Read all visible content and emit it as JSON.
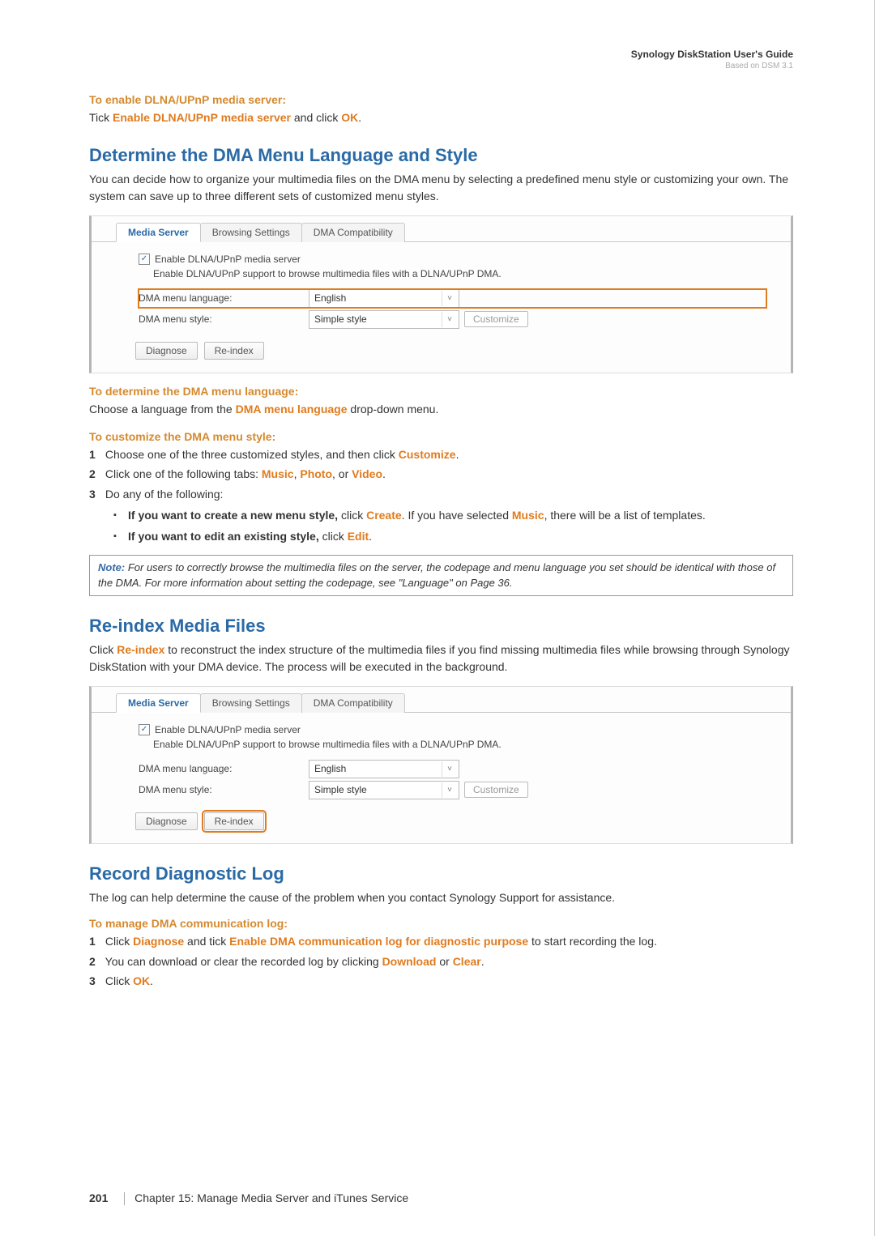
{
  "header": {
    "title": "Synology DiskStation User's Guide",
    "subtitle": "Based on DSM 3.1"
  },
  "enable_section": {
    "sub": "To enable DLNA/UPnP media server:",
    "line_prefix": "Tick ",
    "bold_link": "Enable DLNA/UPnP media server",
    "mid": " and click ",
    "bold_ok": "OK",
    "suffix": "."
  },
  "determine_section": {
    "heading": "Determine the DMA Menu Language and Style",
    "para": "You can decide how to organize your multimedia files on the DMA menu by selecting a predefined menu style or customizing your own. The system can save up to three different sets of customized menu styles."
  },
  "ui_panel": {
    "tabs": [
      "Media Server",
      "Browsing Settings",
      "DMA Compatibility"
    ],
    "checkbox_label": "Enable DLNA/UPnP media server",
    "checkbox_desc": "Enable DLNA/UPnP support to browse multimedia files with a DLNA/UPnP DMA.",
    "lang_label": "DMA menu language:",
    "lang_value": "English",
    "style_label": "DMA menu style:",
    "style_value": "Simple style",
    "customize_btn": "Customize",
    "diagnose_btn": "Diagnose",
    "reindex_btn": "Re-index"
  },
  "determine_steps": {
    "sub1": "To determine the DMA menu language:",
    "line1_pre": "Choose a language from the ",
    "line1_bold": "DMA menu language",
    "line1_post": " drop-down menu.",
    "sub2": "To customize the DMA menu style:",
    "step1_pre": "Choose one of the three customized styles, and then click ",
    "step1_bold": "Customize",
    "step2_pre": "Click one of the following tabs: ",
    "step2_music": "Music",
    "step2_photo": "Photo",
    "step2_video": "Video",
    "step3": "Do any of the following:",
    "b1_bold": "If you want to create a new menu style,",
    "b1_mid": " click ",
    "b1_create": "Create",
    "b1_mid2": ". If you have selected ",
    "b1_music": "Music",
    "b1_post": ", there will be a list of templates.",
    "b2_bold": "If you want to edit an existing style,",
    "b2_mid": " click ",
    "b2_edit": "Edit"
  },
  "note": {
    "label": "Note:",
    "text": " For users to correctly browse the multimedia files on the server, the codepage and menu language you set should be identical with those of the DMA. For more information about setting the codepage, see \"Language\" on Page 36."
  },
  "reindex_section": {
    "heading": "Re-index Media Files",
    "pre": "Click ",
    "bold": "Re-index",
    "post": " to reconstruct the index structure of the multimedia files if you find missing multimedia files while browsing through Synology DiskStation with your DMA device. The process will be executed in the background."
  },
  "diag_section": {
    "heading": "Record Diagnostic Log",
    "para": "The log can help determine the cause of the problem when you contact Synology Support for assistance.",
    "sub": "To manage DMA communication log:",
    "s1_pre": "Click ",
    "s1_diag": "Diagnose",
    "s1_mid": " and tick ",
    "s1_enable": "Enable DMA communication log for diagnostic purpose",
    "s1_post": " to start recording the log.",
    "s2_pre": "You can download or clear the recorded log by clicking ",
    "s2_dl": "Download",
    "s2_or": " or ",
    "s2_clr": "Clear",
    "s3_pre": "Click ",
    "s3_ok": "OK"
  },
  "footer": {
    "page": "201",
    "chapter": "Chapter 15: Manage Media Server and iTunes Service"
  }
}
